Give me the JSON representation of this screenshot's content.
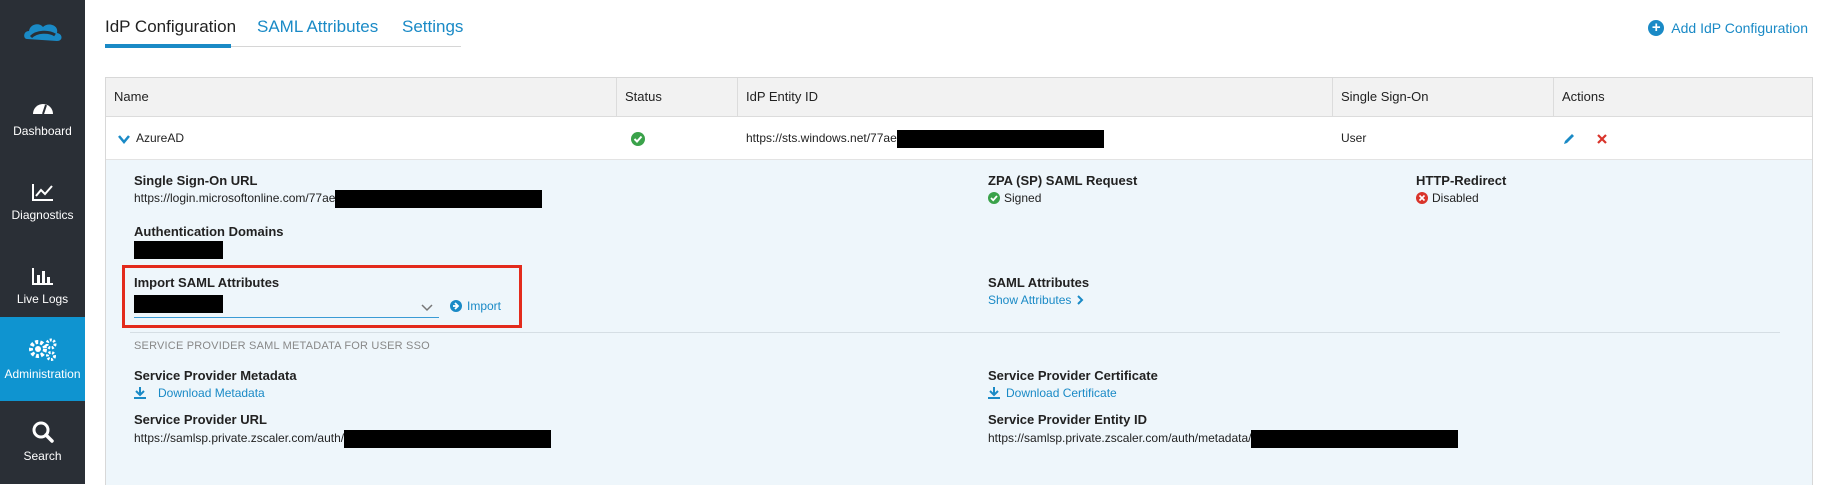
{
  "sidebar": {
    "items": [
      {
        "label": "Dashboard",
        "icon": "gauge-icon"
      },
      {
        "label": "Diagnostics",
        "icon": "chart-line-icon"
      },
      {
        "label": "Live Logs",
        "icon": "bar-chart-icon"
      },
      {
        "label": "Administration",
        "icon": "gears-icon",
        "active": true
      },
      {
        "label": "Search",
        "icon": "search-icon"
      }
    ]
  },
  "tabs": [
    {
      "label": "IdP Configuration",
      "active": true
    },
    {
      "label": "SAML Attributes"
    },
    {
      "label": "Settings"
    }
  ],
  "header": {
    "add_label": "Add IdP Configuration"
  },
  "table": {
    "columns": [
      "Name",
      "Status",
      "IdP Entity ID",
      "Single Sign-On",
      "Actions"
    ],
    "row": {
      "name": "AzureAD",
      "entity_id": "https://sts.windows.net/77ae",
      "sso": "User"
    }
  },
  "detail": {
    "sso_url_label": "Single Sign-On URL",
    "sso_url": "https://login.microsoftonline.com/77ae",
    "zpa_label": "ZPA (SP) SAML Request",
    "zpa_value": "Signed",
    "redirect_label": "HTTP-Redirect",
    "redirect_value": "Disabled",
    "auth_domains_label": "Authentication Domains",
    "import_label": "Import SAML Attributes",
    "import_button": "Import",
    "saml_attr_label": "SAML Attributes",
    "show_attrs": "Show Attributes",
    "section_title": "SERVICE PROVIDER SAML METADATA FOR USER SSO",
    "sp_metadata_label": "Service Provider Metadata",
    "download_metadata": "Download Metadata",
    "sp_cert_label": "Service Provider Certificate",
    "download_cert": "Download Certificate",
    "sp_url_label": "Service Provider URL",
    "sp_url": "https://samlsp.private.zscaler.com/auth/",
    "sp_entity_label": "Service Provider Entity ID",
    "sp_entity": "https://samlsp.private.zscaler.com/auth/metadata/"
  },
  "colors": {
    "accent": "#1a8ac6",
    "active_nav": "#0f94d0",
    "sidebar": "#2a2f36",
    "highlight": "#e32b1c",
    "success": "#3aa24a",
    "error": "#d9342b"
  }
}
